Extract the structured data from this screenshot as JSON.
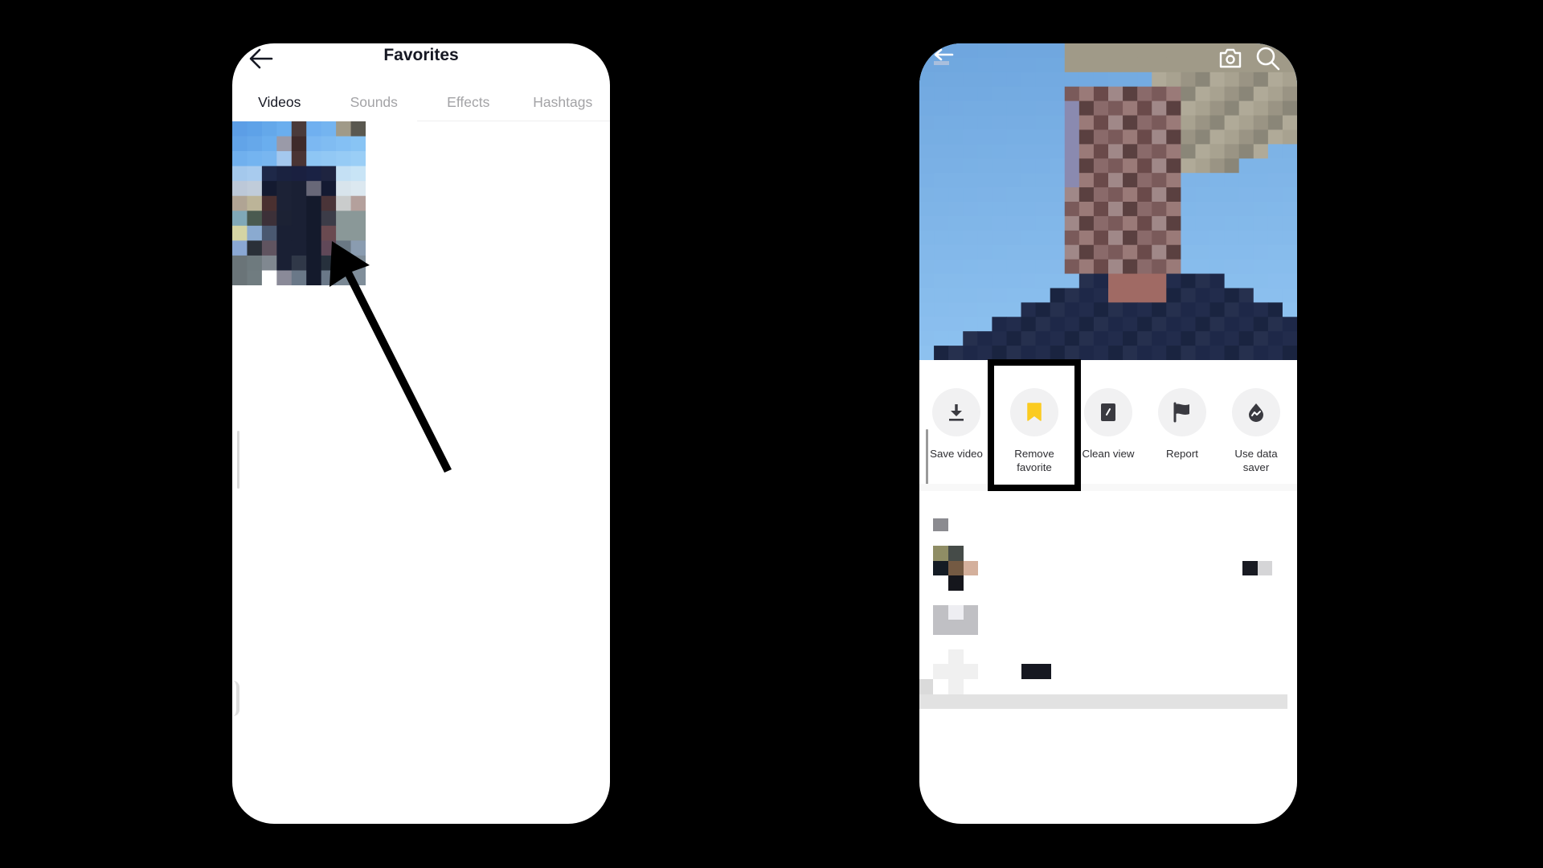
{
  "left_screen": {
    "title": "Favorites",
    "back_icon": "arrow-left-icon",
    "tabs": [
      {
        "label": "Videos",
        "active": true
      },
      {
        "label": "Sounds",
        "active": false
      },
      {
        "label": "Effects",
        "active": false
      },
      {
        "label": "Hashtags",
        "active": false
      }
    ],
    "favorite_videos_count": 1,
    "thumbnail": {
      "description": "pixelated video thumbnail of a person against blue sky"
    }
  },
  "annotation": {
    "type": "arrow",
    "color": "#000000",
    "points_to": "favorited video thumbnail"
  },
  "right_screen": {
    "header_icons": [
      "arrow-left-icon",
      "camera-icon",
      "search-icon"
    ],
    "video": {
      "description": "pixelated video of a person against blue sky"
    },
    "share_actions": [
      {
        "label": "Save video",
        "icon": "download-icon"
      },
      {
        "label": "Remove\nfavorite",
        "icon": "bookmark-icon",
        "highlighted": true
      },
      {
        "label": "Clean view",
        "icon": "clean-view-icon"
      },
      {
        "label": "Report",
        "icon": "flag-icon"
      },
      {
        "label": "Use data\nsaver",
        "icon": "data-saver-icon"
      }
    ],
    "highlight_color": "#000000",
    "favorite_icon_color": "#fbcb20"
  }
}
